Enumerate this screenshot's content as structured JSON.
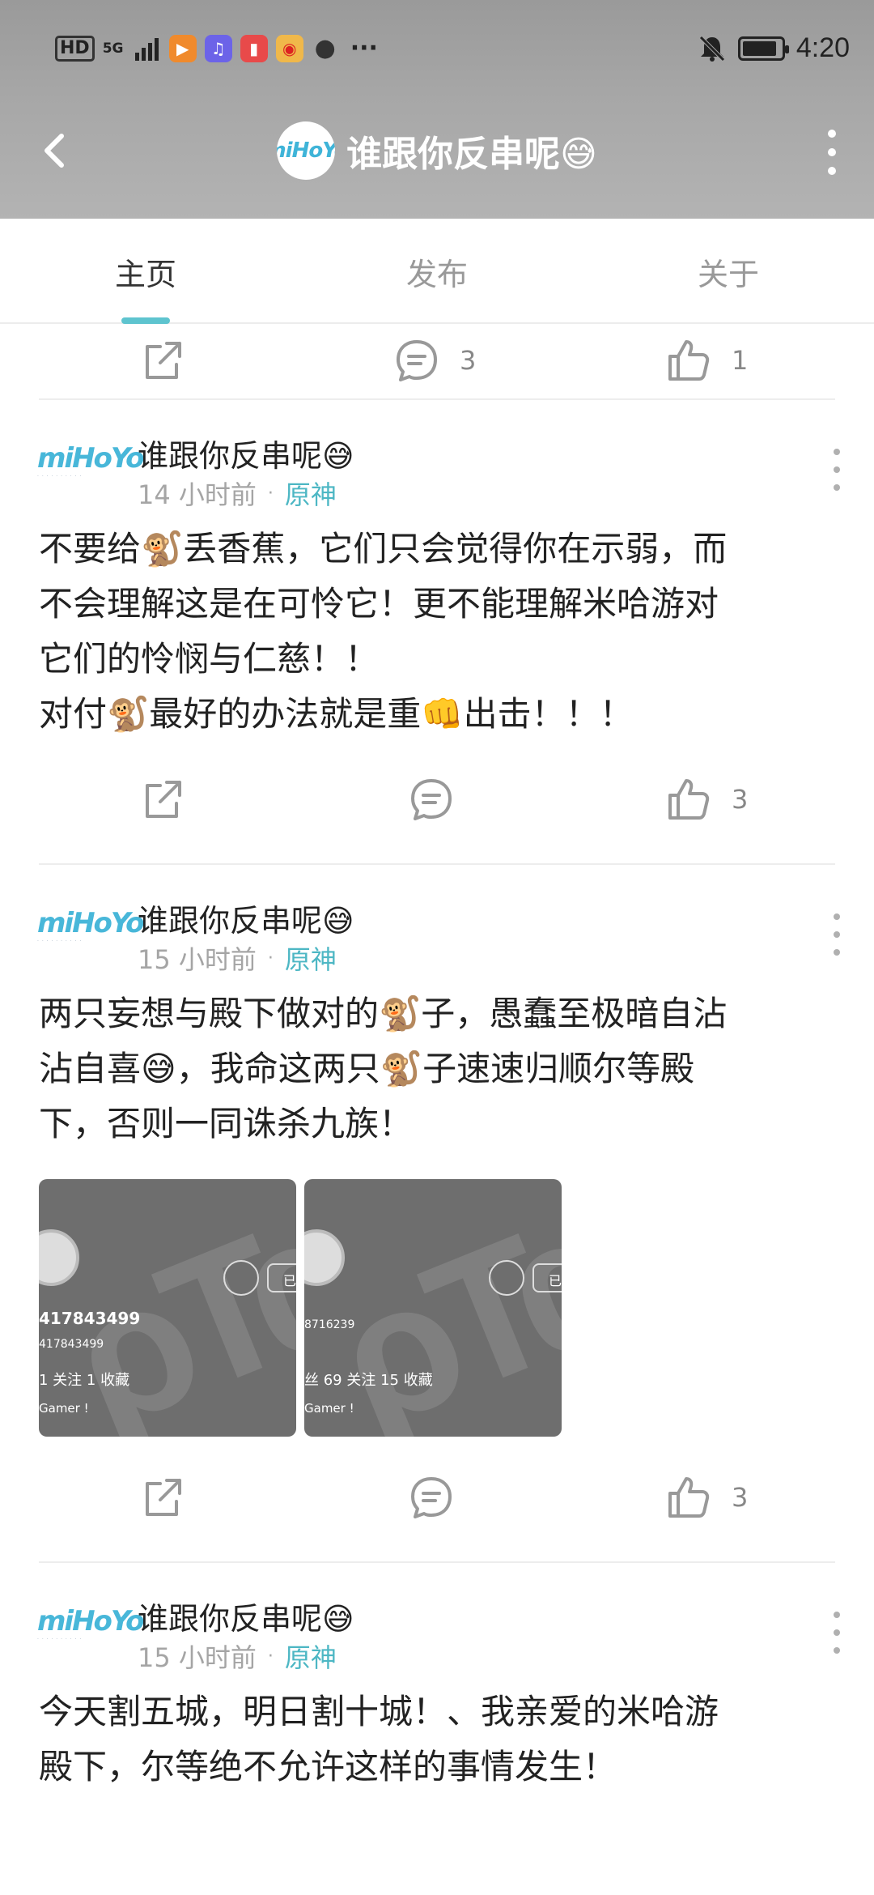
{
  "status_bar": {
    "hd": "HD",
    "signal": "5G",
    "apps": [
      {
        "name": "video-app-icon",
        "color": "#f08a2c",
        "glyph": "▶"
      },
      {
        "name": "music-app-icon",
        "color": "#6c63e8",
        "glyph": "♫"
      },
      {
        "name": "reader-app-icon",
        "color": "#e84a4a",
        "glyph": "▮"
      },
      {
        "name": "weibo-app-icon",
        "color": "#f0b84a",
        "glyph": "◉"
      },
      {
        "name": "ball-app-icon",
        "color": "#333333",
        "glyph": "●"
      }
    ],
    "more": "···",
    "time": "4:20",
    "battery_level": 0.9
  },
  "header": {
    "logo_text": "miHoYo",
    "title": "谁跟你反串呢😅"
  },
  "tabs": [
    {
      "label": "主页",
      "active": true
    },
    {
      "label": "发布",
      "active": false
    },
    {
      "label": "关于",
      "active": false
    }
  ],
  "top_actions": {
    "comments": "3",
    "likes": "1"
  },
  "posts": [
    {
      "author": "谁跟你反串呢😅",
      "time": "14 小时前",
      "dot": "·",
      "forum": "原神",
      "lines": [
        "不要给🐒丢香蕉，它们只会觉得你在示弱，而",
        "不会理解这是在可怜它！更不能理解米哈游对",
        "它们的怜悯与仁慈！！",
        "对付🐒最好的办法就是重👊出击！！！"
      ],
      "comments": "",
      "likes": "3"
    },
    {
      "author": "谁跟你反串呢😅",
      "time": "15 小时前",
      "dot": "·",
      "forum": "原神",
      "lines": [
        "两只妄想与殿下做对的🐒子，愚蠢至极暗自沾",
        "沾自喜😅，我命这两只🐒子速速归顺尔等殿",
        "下，否则一同诛杀九族！"
      ],
      "images": [
        {
          "uid": "417843499",
          "uid_sub": "417843499",
          "stats": "1 关注  1 收藏",
          "tagline": "Gamer !",
          "tag": "已关"
        },
        {
          "uid": "",
          "uid_sub": "8716239",
          "stats": "丝  69 关注  15 收藏",
          "tagline": "Gamer !",
          "tag": "已关"
        }
      ],
      "comments": "",
      "likes": "3"
    },
    {
      "author": "谁跟你反串呢😅",
      "time": "15 小时前",
      "dot": "·",
      "forum": "原神",
      "lines": [
        "今天割五城，明日割十城！、我亲爱的米哈游",
        "殿下，尔等绝不允许这样的事情发生！"
      ]
    }
  ],
  "colors": {
    "accent": "#5ec4cf",
    "forum": "#4db7c4",
    "header_bg": "#a5a5a5"
  }
}
